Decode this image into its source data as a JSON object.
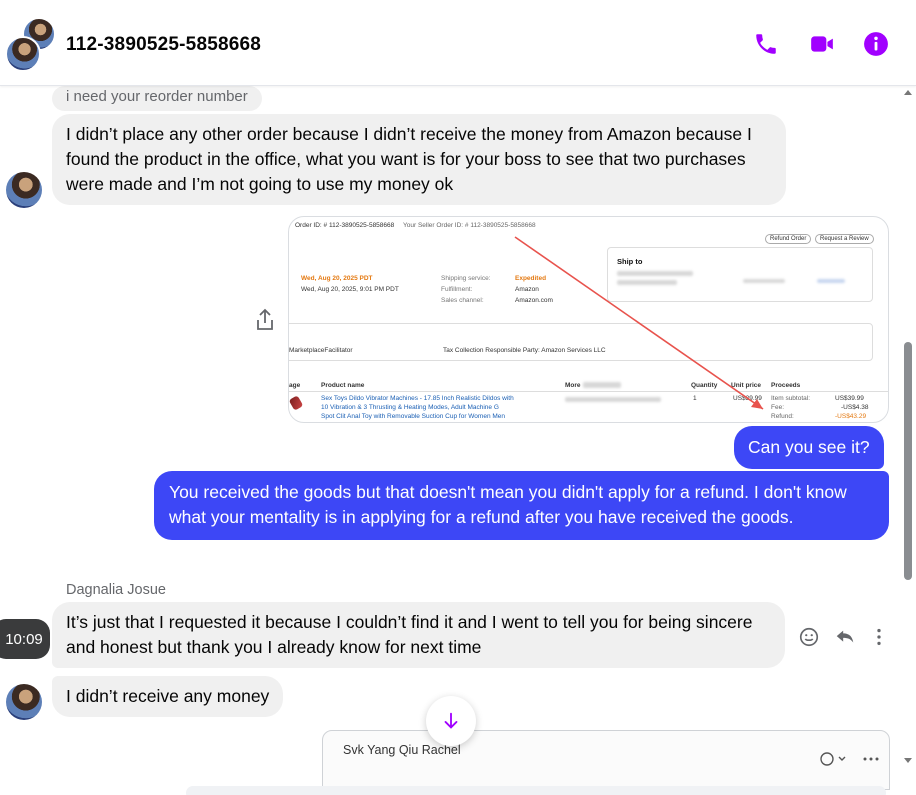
{
  "header": {
    "title": "112-3890525-5858668"
  },
  "messages": {
    "reply_preview": "i need your reorder number",
    "incoming_1": "I didn’t place any other order because I didn’t receive the money from Amazon because I found the product in the office, what you want is for your boss to see that two purchases were made and I’m not going to use my money ok",
    "outgoing_1": "Can you see it?",
    "outgoing_2": "You received the goods but that doesn't mean you didn't apply for a refund. I don't know what your mentality is in applying for a refund after you have received the goods.",
    "sender_name": "Dagnalia Josue",
    "incoming_2": "It’s just that I requested it because I couldn’t find it and I went to tell you for being sincere and honest but thank you I already know for next time",
    "incoming_3": "I didn’t receive any money",
    "hover_time": "10:09"
  },
  "screenshot": {
    "order_id": "Order ID: # 112-3890525-5858668",
    "seller_order_id": "Your Seller Order ID: # 112-3890525-5858668",
    "refund_btn": "Refund Order",
    "review_btn": "Request a Review",
    "ship_to": "Ship to",
    "date_orange": "Wed, Aug 20, 2025 PDT",
    "date_line": "Wed, Aug 20, 2025, 9:01 PM PDT",
    "shipping_service_label": "Shipping service:",
    "shipping_service_value": "Expedited",
    "fulfillment_label": "Fulfillment:",
    "fulfillment_value": "Amazon",
    "sales_channel_label": "Sales channel:",
    "sales_channel_value": "Amazon.com",
    "marketplace": "MarketplaceFacilitator",
    "tax_party": "Tax Collection Responsible Party:  Amazon Services LLC",
    "col_image": "age",
    "col_product": "Product name",
    "col_more": "More",
    "col_qty": "Quantity",
    "col_price": "Unit price",
    "col_proceeds": "Proceeds",
    "product_line1": "Sex Toys Dildo Vibrator Machines - 17.85 Inch Realistic Dildos with",
    "product_line2": "10 Vibration & 3 Thrusting & Heating Modes, Adult Machine G",
    "product_line3": "Spot Clit Anal Toy with Removable Suction Cup for Women Men",
    "qty": "1",
    "price": "US$39.99",
    "item_subtotal_label": "Item subtotal:",
    "item_subtotal_value": "US$39.99",
    "fee_label": "Fee:",
    "fee_value": "-US$4.38",
    "refund_label": "Refund:",
    "refund_value": "-US$43.29"
  },
  "preview": {
    "name": "Svk Yang Qiu Rachel"
  },
  "colors": {
    "accent": "#a100ff",
    "outgoing_bubble": "#3d47f6",
    "incoming_bubble": "#f0f0f0"
  },
  "icons": [
    "phone-icon",
    "video-icon",
    "info-icon",
    "share-icon",
    "emoji-icon",
    "reply-icon",
    "more-icon",
    "arrow-down-icon"
  ]
}
